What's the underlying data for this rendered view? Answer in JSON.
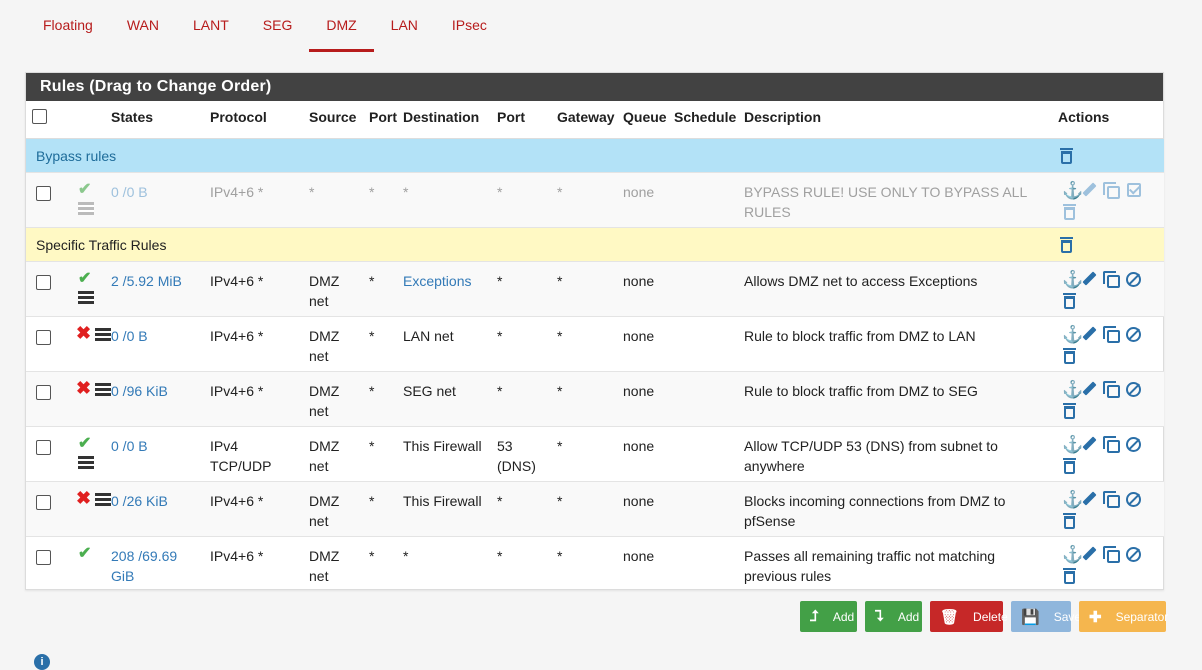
{
  "tabs": [
    {
      "label": "Floating"
    },
    {
      "label": "WAN"
    },
    {
      "label": "LANT"
    },
    {
      "label": "SEG"
    },
    {
      "label": "DMZ",
      "active": true
    },
    {
      "label": "LAN"
    },
    {
      "label": "IPsec"
    }
  ],
  "panel": {
    "title": "Rules (Drag to Change Order)"
  },
  "columns": {
    "states": "States",
    "protocol": "Protocol",
    "source": "Source",
    "port": "Port",
    "destination": "Destination",
    "dport": "Port",
    "gateway": "Gateway",
    "queue": "Queue",
    "schedule": "Schedule",
    "description": "Description",
    "actions": "Actions"
  },
  "separators": {
    "bypass": "Bypass rules",
    "specific": "Specific Traffic Rules"
  },
  "rules": [
    {
      "status": "pass",
      "disabled": true,
      "states": "0 /0 B",
      "protocol": "IPv4+6 *",
      "source": "*",
      "port": "*",
      "destination": "*",
      "dport": "*",
      "gateway": "*",
      "queue": "none",
      "schedule": "",
      "description": "BYPASS RULE! USE ONLY TO BYPASS ALL RULES"
    },
    {
      "status": "pass",
      "states": "2 /5.92 MiB",
      "protocol": "IPv4+6 *",
      "source": "DMZ net",
      "port": "*",
      "destination": "Exceptions",
      "dport": "*",
      "gateway": "*",
      "queue": "none",
      "schedule": "",
      "description": "Allows DMZ net to access Exceptions"
    },
    {
      "status": "block",
      "states": "0 /0 B",
      "protocol": "IPv4+6 *",
      "source": "DMZ net",
      "port": "*",
      "destination": "LAN net",
      "dport": "*",
      "gateway": "*",
      "queue": "none",
      "schedule": "",
      "description": "Rule to block traffic from DMZ to LAN"
    },
    {
      "status": "block",
      "states": "0 /96 KiB",
      "protocol": "IPv4+6 *",
      "source": "DMZ net",
      "port": "*",
      "destination": "SEG net",
      "dport": "*",
      "gateway": "*",
      "queue": "none",
      "schedule": "",
      "description": "Rule to block traffic from DMZ to SEG"
    },
    {
      "status": "pass",
      "states": "0 /0 B",
      "protocol": "IPv4 TCP/UDP",
      "source": "DMZ net",
      "port": "*",
      "destination": "This Firewall",
      "dport": "53 (DNS)",
      "gateway": "*",
      "queue": "none",
      "schedule": "",
      "description": "Allow TCP/UDP 53 (DNS) from subnet to anywhere"
    },
    {
      "status": "block",
      "states": "0 /26 KiB",
      "protocol": "IPv4+6 *",
      "source": "DMZ net",
      "port": "*",
      "destination": "This Firewall",
      "dport": "*",
      "gateway": "*",
      "queue": "none",
      "schedule": "",
      "description": "Blocks incoming connections from DMZ to pfSense"
    },
    {
      "status": "pass",
      "states": "208 /69.69 GiB",
      "protocol": "IPv4+6 *",
      "source": "DMZ net",
      "port": "*",
      "destination": "*",
      "dport": "*",
      "gateway": "*",
      "queue": "none",
      "schedule": "",
      "description": "Passes all remaining traffic not matching previous rules"
    }
  ],
  "buttons": {
    "add_top": "Add",
    "add_bottom": "Add",
    "delete": "Delete",
    "save": "Save",
    "separator": "Separator"
  },
  "colors": {
    "accent": "#b71c1c",
    "header_bg": "#424242",
    "bypass_sep": "#b3e2f7",
    "specific_sep": "#fff9c4",
    "link": "#337ab7",
    "pass": "#4caf50",
    "block": "#e02020"
  },
  "icons": {
    "pass": "check-icon",
    "block": "x-icon",
    "states": "list-icon",
    "actions": [
      "anchor-icon",
      "pencil-icon",
      "copy-icon",
      "ban-icon",
      "trash-icon"
    ]
  }
}
